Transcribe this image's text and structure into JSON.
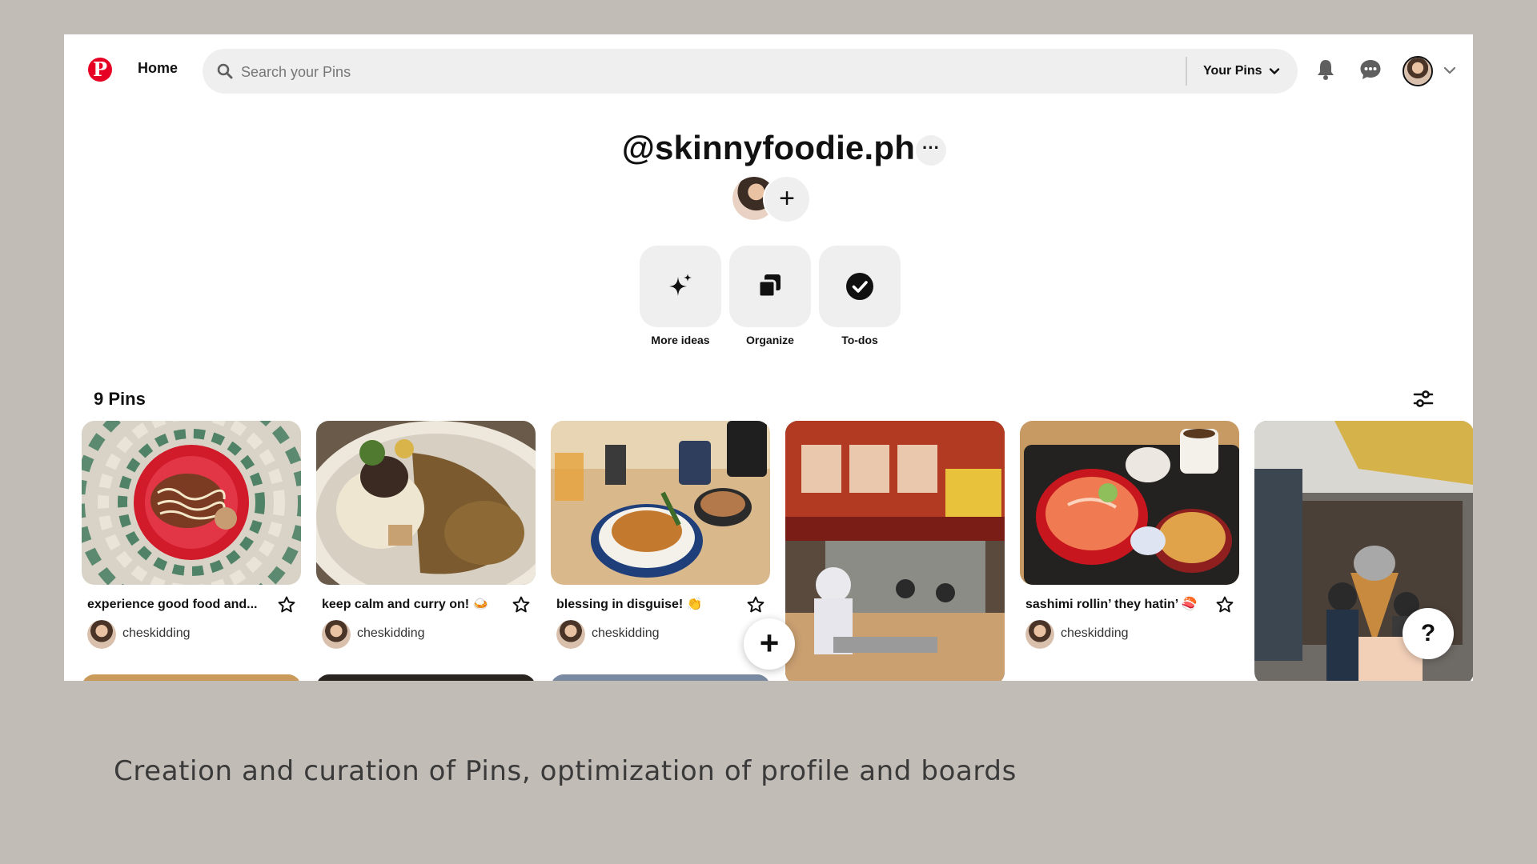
{
  "header": {
    "logo_letter": "P",
    "home_label": "Home",
    "search_placeholder": "Search your Pins",
    "your_pins_label": "Your Pins"
  },
  "board": {
    "title": "@skinnyfoodie.ph",
    "more_label": "···",
    "add_collaborator_label": "+"
  },
  "actions": [
    {
      "label": "More ideas",
      "icon": "sparkle-icon"
    },
    {
      "label": "Organize",
      "icon": "organize-icon"
    },
    {
      "label": "To-dos",
      "icon": "check-circle-icon"
    }
  ],
  "pins_count": "9 Pins",
  "pins": [
    {
      "title": "experience good food and...",
      "user": "cheskidding"
    },
    {
      "title": "keep calm and curry on! 🍛",
      "user": "cheskidding"
    },
    {
      "title": "blessing in disguise! 👏",
      "user": "cheskidding"
    },
    {
      "title": "",
      "user": ""
    },
    {
      "title": "sashimi rollin’ they hatin’ 🍣",
      "user": "cheskidding"
    },
    {
      "title": "",
      "user": ""
    }
  ],
  "fab": {
    "add_label": "+",
    "help_label": "?"
  },
  "caption": "Creation and curation of Pins, optimization of profile and boards",
  "colors": {
    "brand": "#e60023",
    "background": "#c2bcb6",
    "chip": "#efefef"
  }
}
